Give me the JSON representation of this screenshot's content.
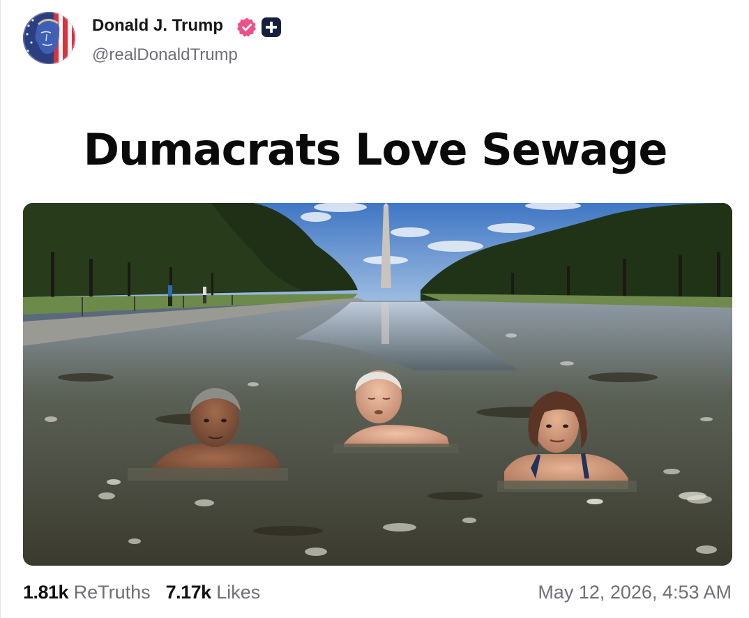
{
  "post": {
    "author": {
      "display_name": "Donald J. Trump",
      "handle": "@realDonaldTrump",
      "avatar_icon": "flag-portrait-avatar",
      "verified_icon": "verified-badge-icon",
      "plus_icon": "plus-badge-icon"
    },
    "caption": "Dumacrats Love Sewage",
    "stats": {
      "retruths_count": "1.81k",
      "retruths_label": "ReTruths",
      "likes_count": "7.17k",
      "likes_label": "Likes"
    },
    "timestamp": "May 12, 2026, 4:53 AM"
  },
  "colors": {
    "verified_badge": "#f0508a",
    "plus_badge": "#16203d",
    "muted_text": "#6e6e78",
    "primary_text": "#111111"
  }
}
